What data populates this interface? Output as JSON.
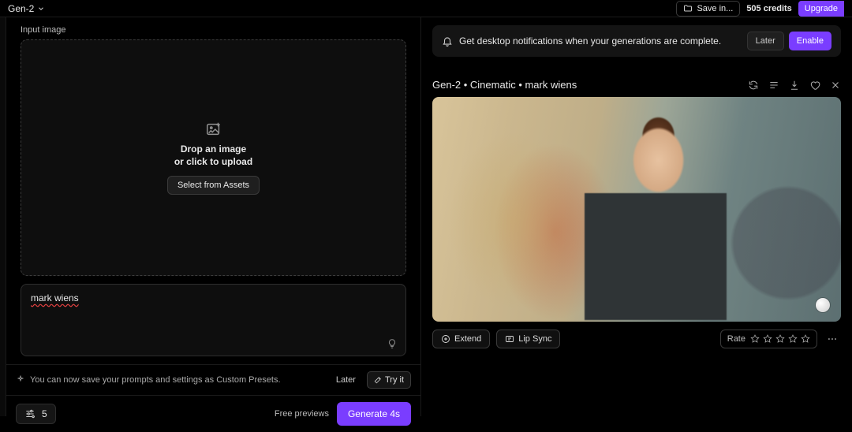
{
  "topbar": {
    "model": "Gen-2",
    "save_label": "Save in...",
    "credits": "505 credits",
    "upgrade_label": "Upgrade"
  },
  "left": {
    "section_label": "Input image",
    "drop_line1": "Drop an image",
    "drop_line2": "or click to upload",
    "select_assets": "Select from Assets",
    "prompt_value": "mark wiens",
    "tip_text": "You can now save your prompts and settings as Custom Presets.",
    "later": "Later",
    "try_it": "Try it",
    "settings_count": "5",
    "free_previews": "Free previews",
    "generate_label": "Generate 4s"
  },
  "right": {
    "notif_text": "Get desktop notifications when your generations are complete.",
    "notif_later": "Later",
    "notif_enable": "Enable",
    "result_title": "Gen-2 • Cinematic • mark wiens",
    "extend_label": "Extend",
    "lipsync_label": "Lip Sync",
    "rate_label": "Rate"
  }
}
